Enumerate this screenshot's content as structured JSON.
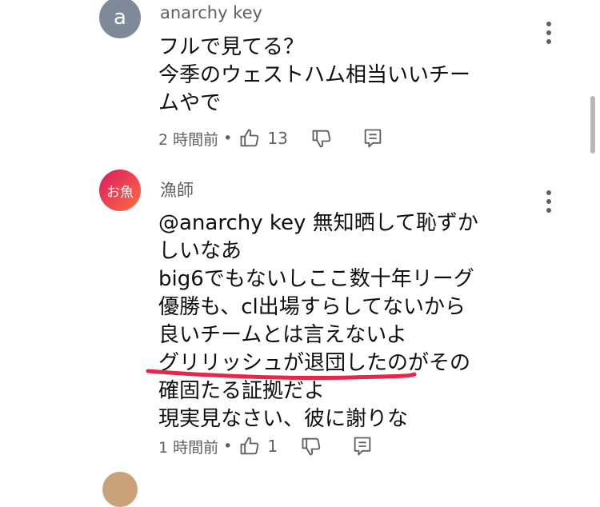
{
  "comments": [
    {
      "avatar_letter": "a",
      "username": "anarchy key",
      "lines": [
        "フルで見てる？",
        "今季のウェストハム相当いいチー",
        "ムやで"
      ],
      "time": "2 時間前",
      "separator": "•",
      "likes": "13"
    },
    {
      "avatar_letter": "お魚",
      "username": "漁師",
      "lines": [
        " @anarchy key  無知晒して恥ずか",
        "しいなあ",
        "big6でもないしここ数十年リーグ",
        "優勝も、cl出場すらしてないから",
        "良いチームとは言えないよ",
        "グリリッシュが退団したのがその",
        "確固たる証拠だよ",
        "現実見なさい、彼に謝りな"
      ],
      "time": "1 時間前",
      "separator": "•",
      "likes": "1"
    }
  ],
  "colors": {
    "annotation_red": "#e8254b",
    "meta_gray": "#606060"
  },
  "icons": [
    "thumbs-up-icon",
    "thumbs-down-icon",
    "reply-icon",
    "more-vert-icon"
  ]
}
